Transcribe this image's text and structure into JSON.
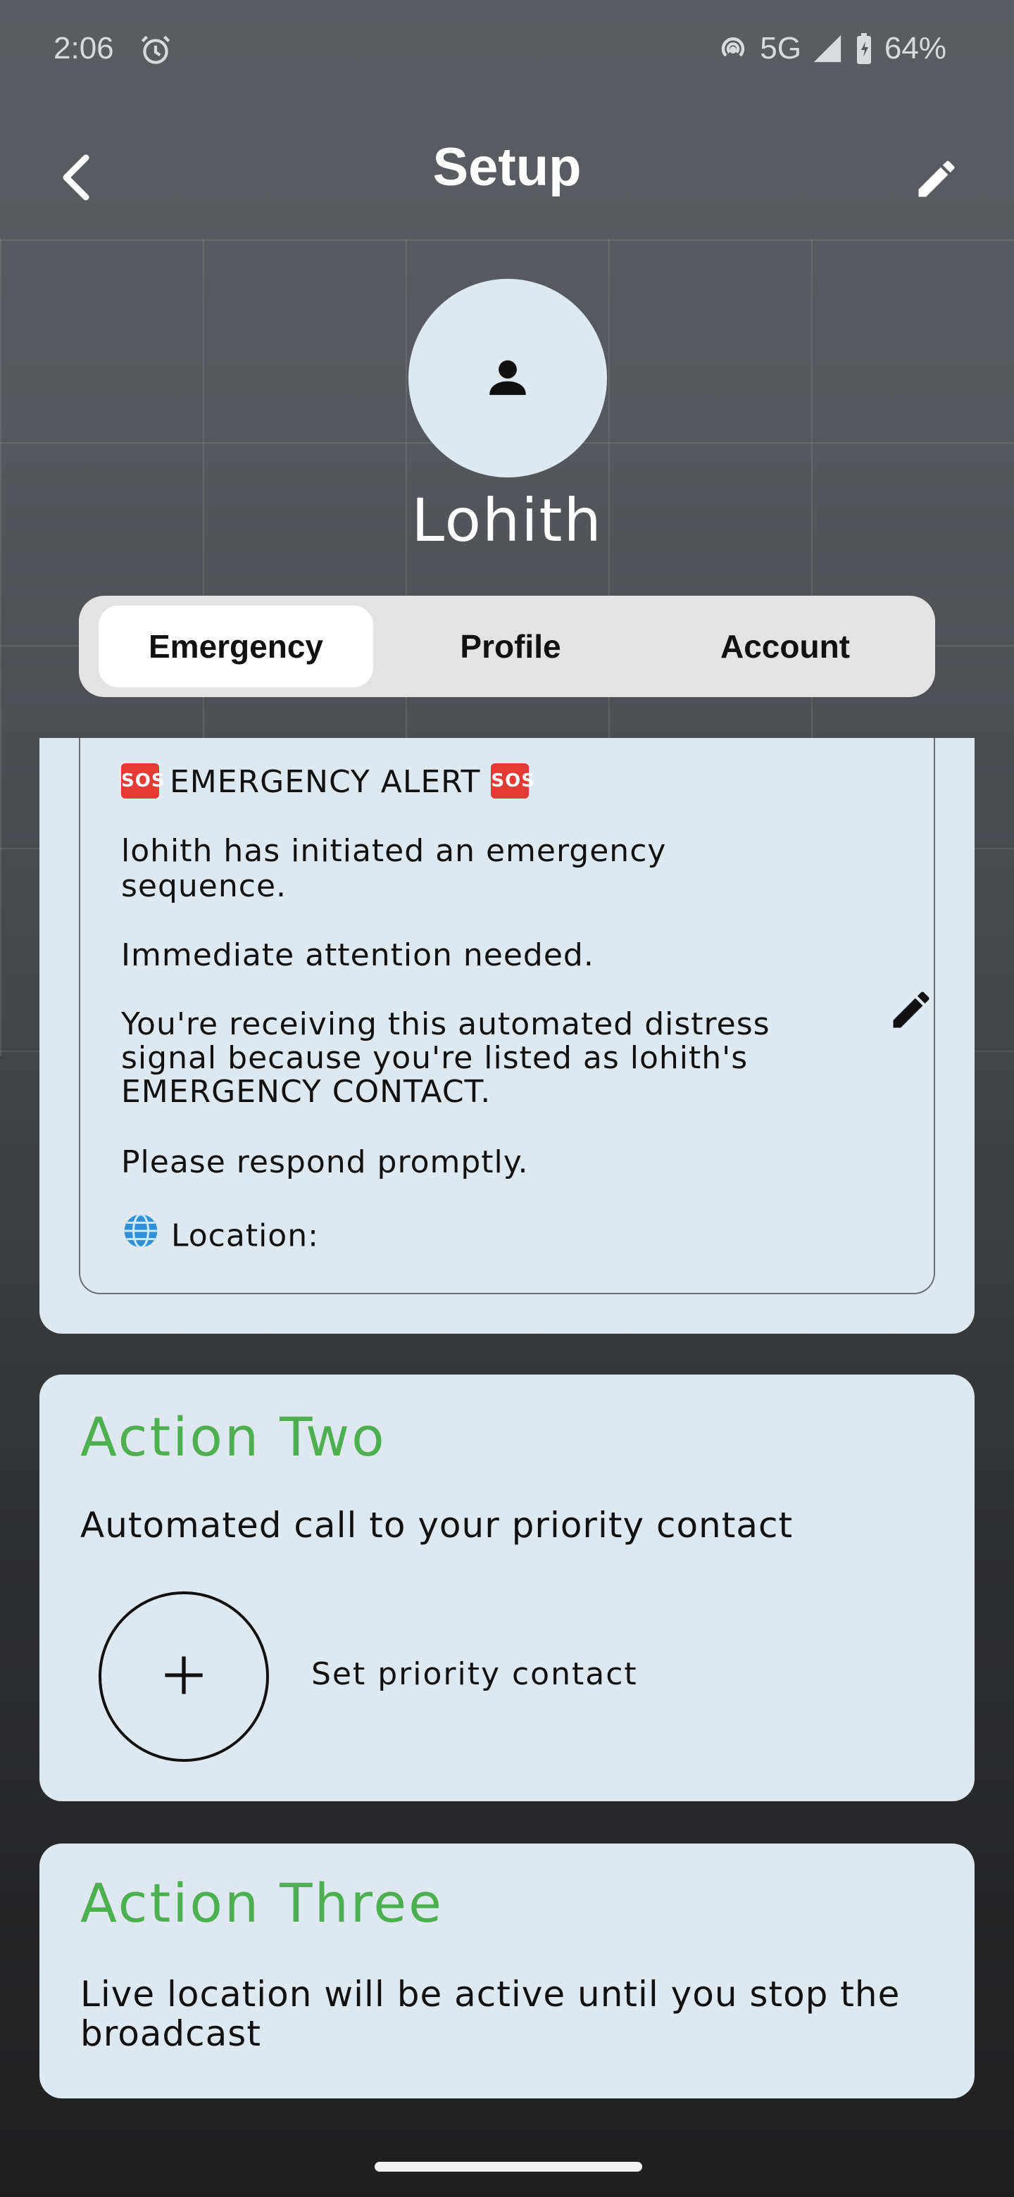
{
  "status_bar": {
    "time": "2:06",
    "network": "5G",
    "battery": "64%"
  },
  "header": {
    "title": "Setup"
  },
  "profile": {
    "name": "Lohith"
  },
  "tabs": [
    {
      "label": "Emergency",
      "active": true
    },
    {
      "label": "Profile",
      "active": false
    },
    {
      "label": "Account",
      "active": false
    }
  ],
  "action_one": {
    "message": {
      "heading": "EMERGENCY ALERT",
      "sos_badge": "SOS",
      "line1a": "lohith has initiated an emergency",
      "line1b": "sequence.",
      "line2": "Immediate attention needed.",
      "line3a": "You're receiving this automated distress",
      "line3b": "signal because you're listed as lohith's",
      "line3c": "EMERGENCY CONTACT.",
      "line4": "Please respond promptly.",
      "location_label": "Location:"
    }
  },
  "action_two": {
    "title": "Action Two",
    "description": "Automated call to your priority contact",
    "add_label": "Set priority contact"
  },
  "action_three": {
    "title": "Action Three",
    "description_a": "Live location will be active until you stop the",
    "description_b": "broadcast"
  },
  "colors": {
    "accent_green": "#4caf50",
    "card_bg": "#dfe8ee",
    "sos_red": "#e53935"
  }
}
